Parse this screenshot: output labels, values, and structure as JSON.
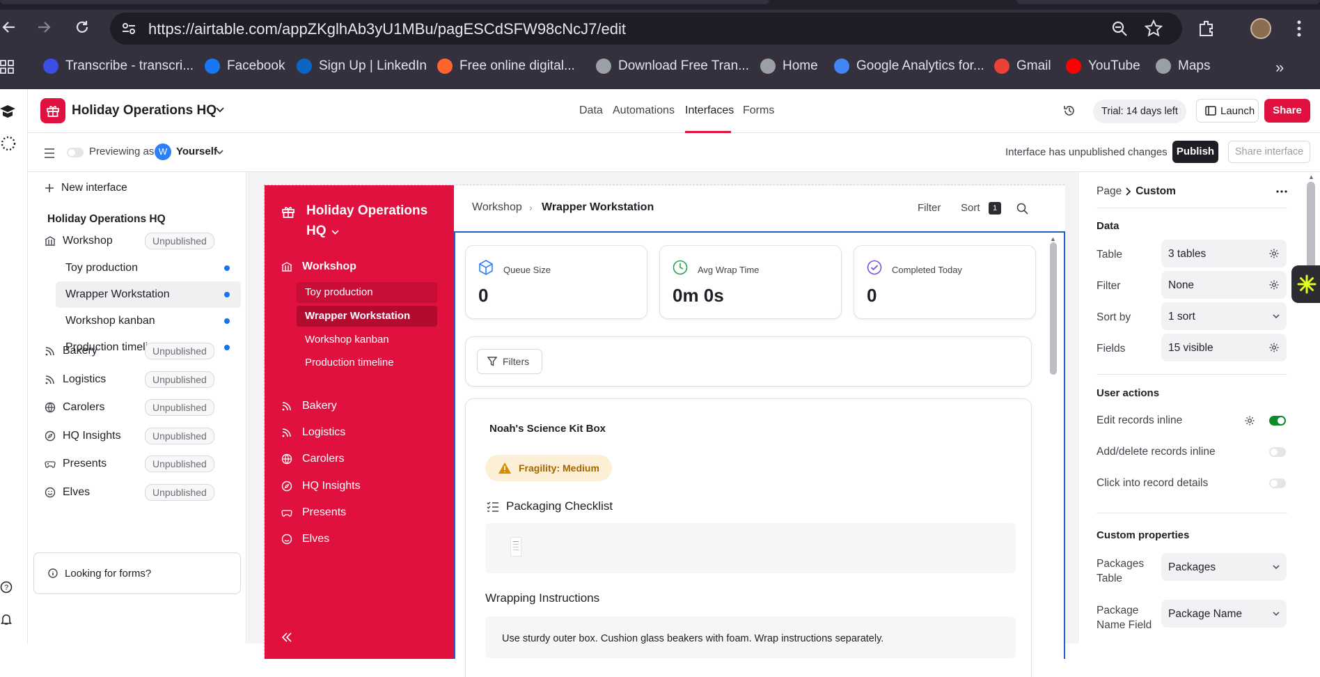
{
  "browser": {
    "url": "https://airtable.com/appZKglhAb3yU1MBu/pagESCdSFW98cNcJ7/edit",
    "bookmarks": [
      {
        "label": "Transcribe - transcri...",
        "icon": "transcribe-icon",
        "color": "#3b4fe4"
      },
      {
        "label": "Facebook",
        "icon": "facebook-icon",
        "color": "#1877f2"
      },
      {
        "label": "Sign Up | LinkedIn",
        "icon": "linkedin-icon",
        "color": "#0a66c2"
      },
      {
        "label": "Free online digital...",
        "icon": "semrush-icon",
        "color": "#ff642d"
      },
      {
        "label": "Download Free Tran...",
        "icon": "globe-icon",
        "color": "#9aa0a6"
      },
      {
        "label": "Home",
        "icon": "globe-icon",
        "color": "#9aa0a6"
      },
      {
        "label": "Google Analytics for...",
        "icon": "google-icon",
        "color": "#4285f4"
      },
      {
        "label": "Gmail",
        "icon": "gmail-icon",
        "color": "#ea4335"
      },
      {
        "label": "YouTube",
        "icon": "youtube-icon",
        "color": "#ff0000"
      },
      {
        "label": "Maps",
        "icon": "globe-icon",
        "color": "#9aa0a6"
      }
    ]
  },
  "topbar": {
    "base_name": "Holiday Operations HQ",
    "nav": [
      "Data",
      "Automations",
      "Interfaces",
      "Forms"
    ],
    "active_nav": "Interfaces",
    "trial": "Trial: 14 days left",
    "launch": "Launch",
    "share": "Share",
    "brand_color": "#e0113e"
  },
  "subbar": {
    "previewing_as": "Previewing as",
    "avatar_letter": "W",
    "user": "Yourself",
    "unpublished_note": "Interface has unpublished changes",
    "publish": "Publish",
    "share_interface": "Share interface"
  },
  "sidebar": {
    "new_interface": "New interface",
    "heading": "Holiday Operations HQ",
    "groups": [
      {
        "label": "Workshop",
        "badge": "Unpublished",
        "icon": "museum-icon"
      },
      {
        "label": "Bakery",
        "badge": "Unpublished",
        "icon": "rss-icon"
      },
      {
        "label": "Logistics",
        "badge": "Unpublished",
        "icon": "rss-icon"
      },
      {
        "label": "Carolers",
        "badge": "Unpublished",
        "icon": "globe-icon"
      },
      {
        "label": "HQ Insights",
        "badge": "Unpublished",
        "icon": "compass-icon"
      },
      {
        "label": "Presents",
        "badge": "Unpublished",
        "icon": "gamepad-icon"
      },
      {
        "label": "Elves",
        "badge": "Unpublished",
        "icon": "smile-icon"
      }
    ],
    "workshop_pages": [
      "Toy production",
      "Wrapper Workstation",
      "Workshop kanban",
      "Production timeline"
    ],
    "selected_page": "Wrapper Workstation",
    "forms_hint": "Looking for forms?"
  },
  "interface": {
    "title_line1": "Holiday Operations",
    "title_line2": "HQ",
    "nav": [
      "Workshop",
      "Bakery",
      "Logistics",
      "Carolers",
      "HQ Insights",
      "Presents",
      "Elves"
    ],
    "workshop_pages": [
      "Toy production",
      "Wrapper Workstation",
      "Workshop kanban",
      "Production timeline"
    ],
    "breadcrumb_parent": "Workshop",
    "breadcrumb_current": "Wrapper Workstation",
    "filter": "Filter",
    "sort": "Sort",
    "sort_count": "1",
    "stats": [
      {
        "label": "Queue Size",
        "value": "0",
        "icon": "box-icon",
        "color": "#2d7ff9"
      },
      {
        "label": "Avg Wrap Time",
        "value": "0m 0s",
        "icon": "clock-icon",
        "color": "#20a34a"
      },
      {
        "label": "Completed Today",
        "value": "0",
        "icon": "check-circle-icon",
        "color": "#7c4dde"
      }
    ],
    "filters_button": "Filters",
    "record": {
      "title": "Noah's Science Kit Box",
      "fragility": "Fragility: Medium",
      "checklist_heading": "Packaging Checklist",
      "instructions_heading": "Wrapping Instructions",
      "instructions_text": "Use sturdy outer box. Cushion glass beakers with foam. Wrap instructions separately."
    }
  },
  "props": {
    "breadcrumb_page": "Page",
    "breadcrumb_current": "Custom",
    "data_heading": "Data",
    "data_rows": [
      {
        "label": "Table",
        "value": "3 tables",
        "control": "gear"
      },
      {
        "label": "Filter",
        "value": "None",
        "control": "gear"
      },
      {
        "label": "Sort by",
        "value": "1 sort",
        "control": "chevron"
      },
      {
        "label": "Fields",
        "value": "15 visible",
        "control": "gear"
      }
    ],
    "user_actions_heading": "User actions",
    "user_actions": [
      {
        "label": "Edit records inline",
        "on": true
      },
      {
        "label": "Add/delete records inline",
        "on": false
      },
      {
        "label": "Click into record details",
        "on": false
      }
    ],
    "custom_heading": "Custom properties",
    "custom_rows": [
      {
        "label_line1": "Packages",
        "label_line2": "Table",
        "value": "Packages"
      },
      {
        "label_line1": "Package",
        "label_line2": "Name Field",
        "value": "Package Name"
      }
    ]
  }
}
